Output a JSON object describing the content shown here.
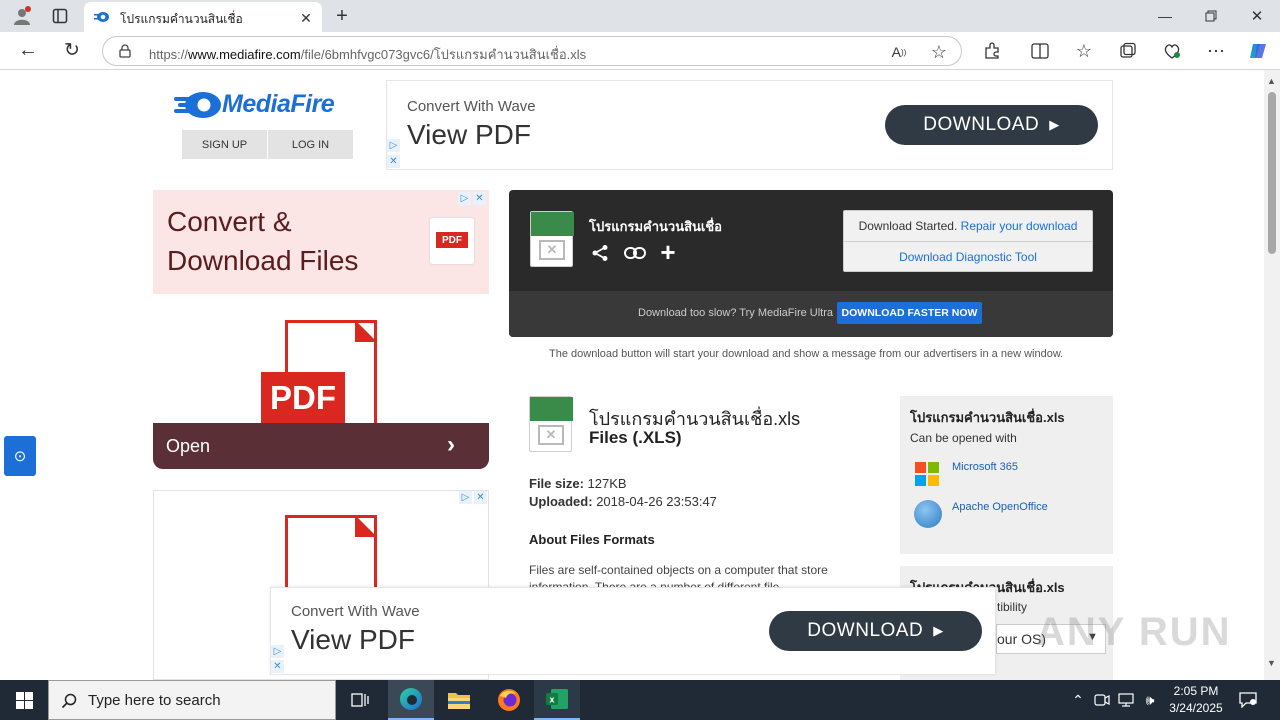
{
  "browser": {
    "tab_title": "โปรแกรมคำนวนสินเชื่อ",
    "url_prefix": "https://",
    "url_domain": "www.mediafire.com",
    "url_path": "/file/6bmhfvgc073gvc6/โปรแกรมคำนวนสินเชื่อ.xls"
  },
  "header": {
    "logo_text": "MediaFire",
    "signup_label": "SIGN UP",
    "login_label": "LOG IN"
  },
  "top_ad": {
    "subtitle": "Convert With Wave",
    "title": "View PDF",
    "button_label": "DOWNLOAD"
  },
  "left_ad1": {
    "text_line1": "Convert &",
    "text_line2": "Download Files",
    "pdf_label": "PDF"
  },
  "left_ad2": {
    "pdf_label": "PDF",
    "open_label": "Open"
  },
  "download_box": {
    "file_name": "โปรแกรมคำนวนสินเชื่อ",
    "status_text": "Download Started.",
    "repair_link": "Repair your download",
    "diagnostic_link": "Download Diagnostic Tool",
    "slow_text": "Download too slow? Try MediaFire Ultra",
    "faster_button": "DOWNLOAD FASTER NOW",
    "notice": "The download button will start your download and show a message from our advertisers in a new window."
  },
  "file_info": {
    "file_title": "โปรแกรมคำนวนสินเชื่อ.xls",
    "file_type": "Files (.XLS)",
    "size_label": "File size:",
    "size_value": "127KB",
    "uploaded_label": "Uploaded:",
    "uploaded_value": "2018-04-26 23:53:47",
    "about_heading": "About Files Formats",
    "about_text": "Files are self-contained objects on a computer that store information. There are a number of different file"
  },
  "sidebar": {
    "box1_title": "โปรแกรมคำนวนสินเชื่อ.xls",
    "box1_subtitle": "Can be opened with",
    "app1": "Microsoft 365",
    "app2": "Apache OpenOffice",
    "box2_title": "โปรแกรมคำนวนสินเชื่อ.xls",
    "box2_line": "tibility",
    "box2_select": "our OS)"
  },
  "bottom_ad": {
    "subtitle": "Convert With Wave",
    "title": "View PDF",
    "button_label": "DOWNLOAD"
  },
  "watermark": "ANY RUN",
  "taskbar": {
    "search_placeholder": "Type here to search",
    "time": "2:05 PM",
    "date": "3/24/2025"
  }
}
